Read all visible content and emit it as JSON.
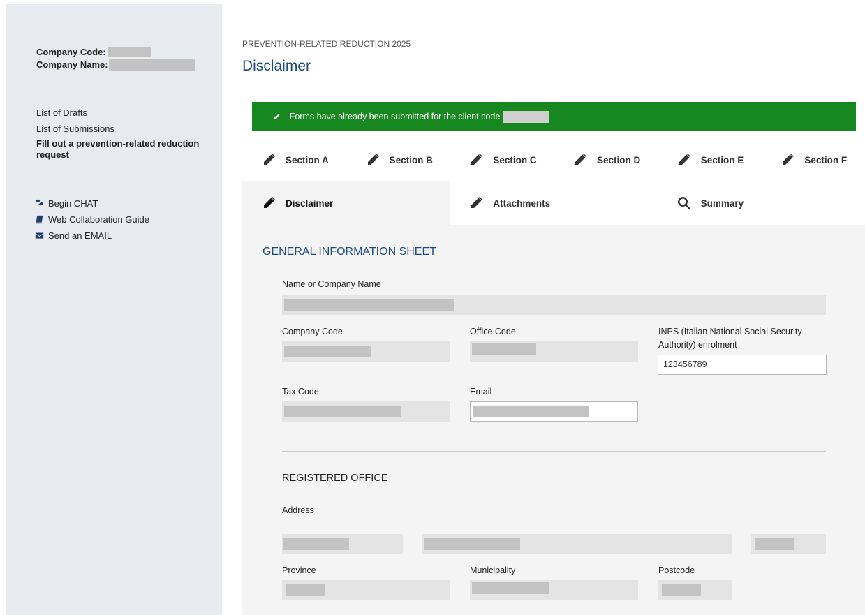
{
  "sidebar": {
    "company_code_label": "Company Code:",
    "company_name_label": "Company Name:",
    "nav": {
      "drafts": "List of Drafts",
      "submissions": "List of Submissions",
      "fill_request": "Fill out a prevention-related reduction request"
    },
    "help": {
      "chat": "Begin CHAT",
      "guide": "Web Collaboration Guide",
      "email": "Send an EMAIL"
    }
  },
  "header": {
    "breadcrumb": "PREVENTION-RELATED REDUCTION 2025",
    "title": "Disclaimer"
  },
  "banner": {
    "text": "Forms have already been submitted for the client code",
    "color": "#17871f"
  },
  "tabs_row1": [
    "Section A",
    "Section B",
    "Section C",
    "Section D",
    "Section E",
    "Section F"
  ],
  "tabs_row2": {
    "disclaimer": "Disclaimer",
    "attachments": "Attachments",
    "summary": "Summary"
  },
  "form": {
    "section_title": "GENERAL INFORMATION SHEET",
    "name_label": "Name or Company Name",
    "company_code_label": "Company Code",
    "office_code_label": "Office Code",
    "inps_label": "INPS (Italian National Social Security Authority) enrolment",
    "inps_value": "123456789",
    "tax_code_label": "Tax Code",
    "email_label": "Email",
    "registered_office_title": "REGISTERED OFFICE",
    "address_label": "Address",
    "province_label": "Province",
    "municipality_label": "Municipality",
    "postcode_label": "Postcode"
  },
  "colors": {
    "accent": "#1d4a80",
    "sidebar_bg": "#e7eaef",
    "panel_bg": "#f4f4f4"
  },
  "icons": {
    "chat": "chat-bubbles-icon",
    "guide": "book-icon",
    "email": "envelope-icon",
    "tab_edit": "pencil-icon",
    "tab_summary": "search-icon",
    "banner": "check-icon"
  }
}
